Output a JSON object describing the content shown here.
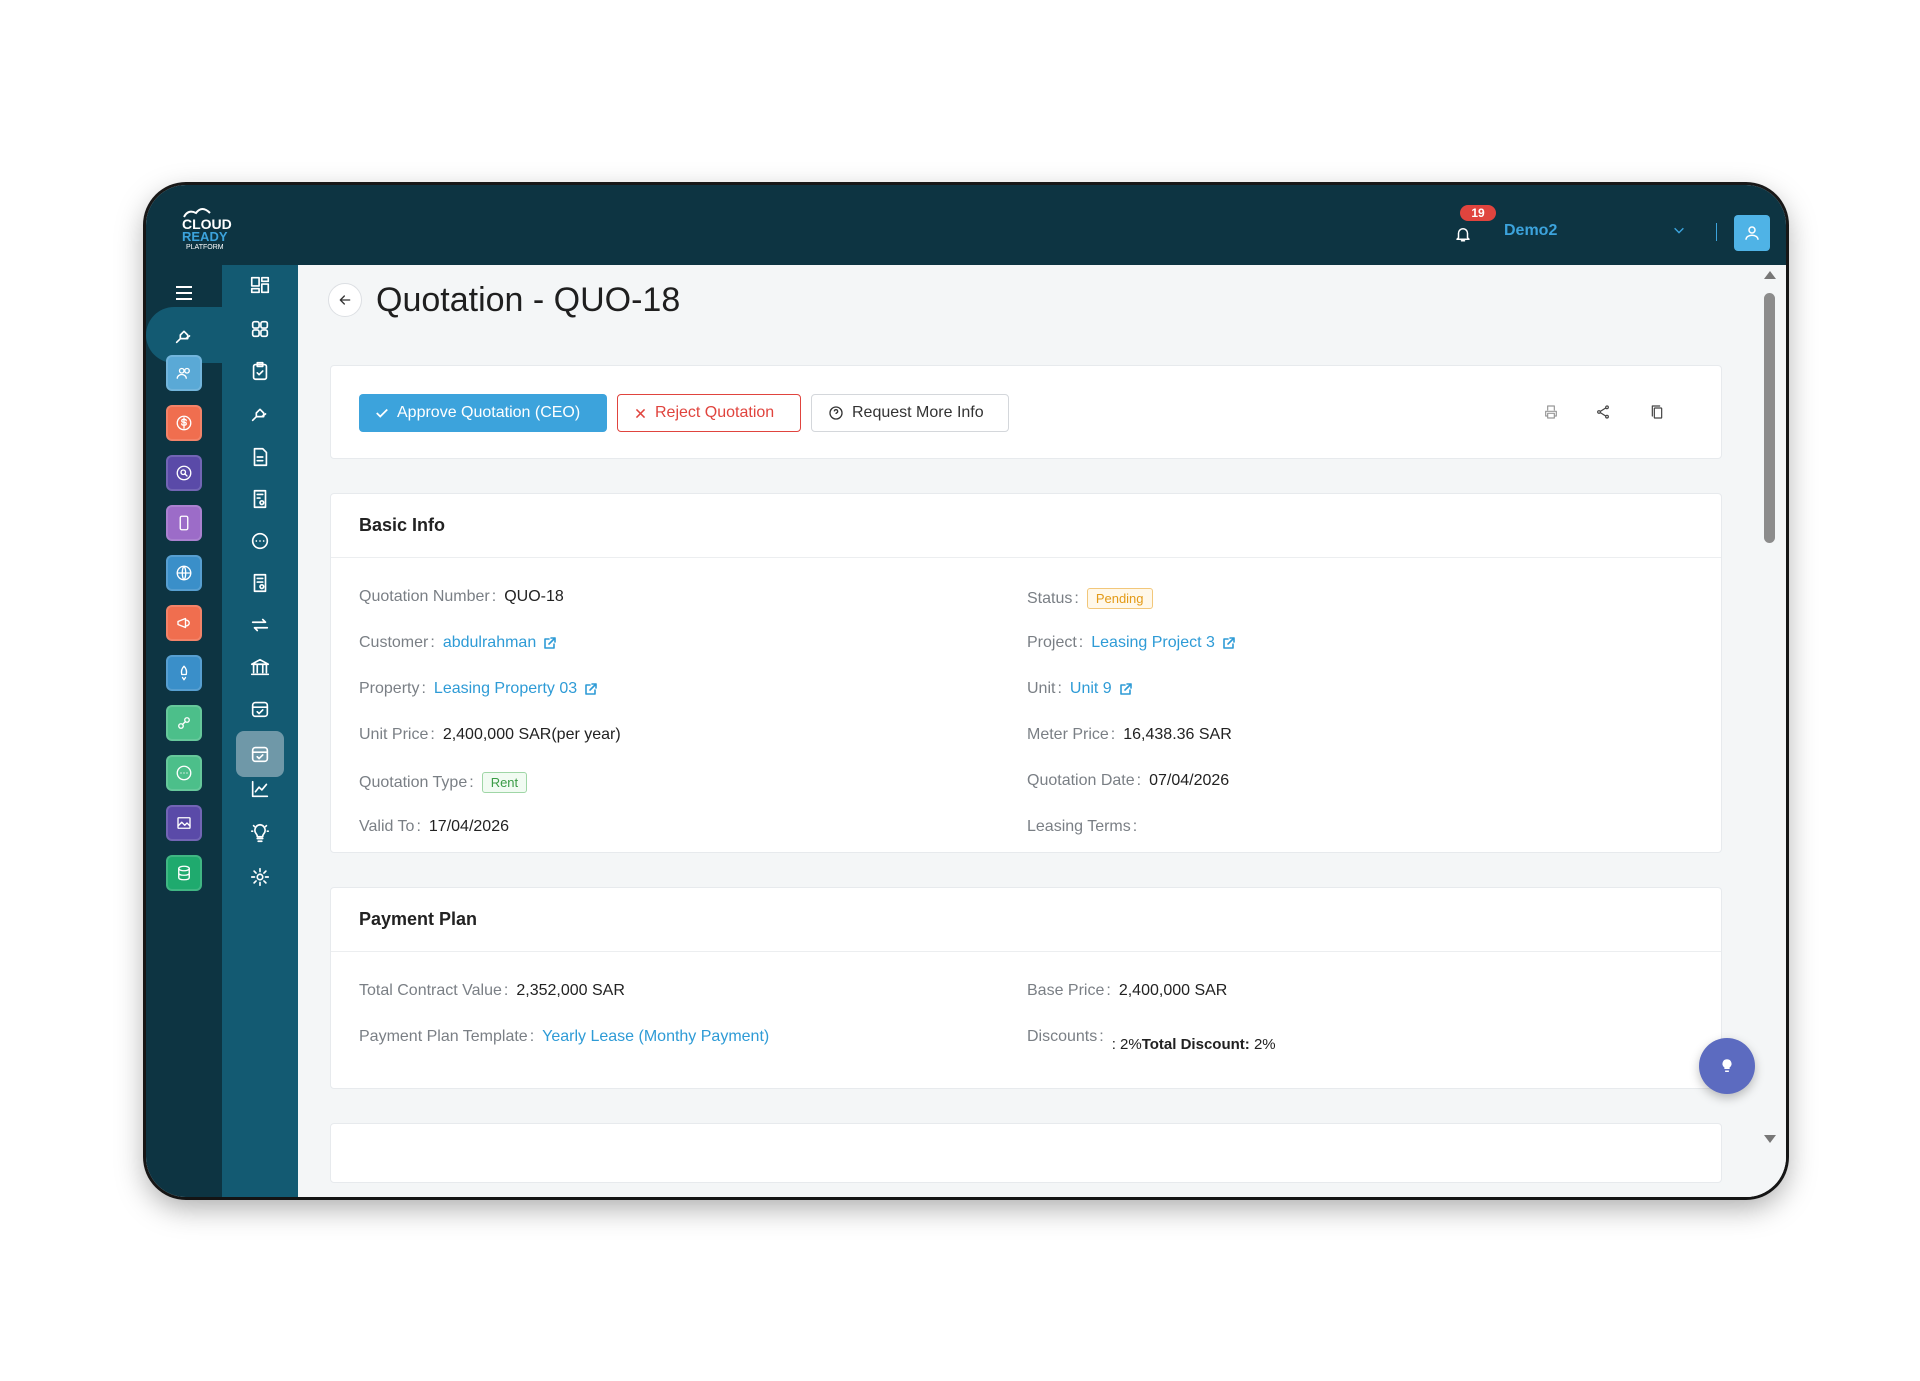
{
  "header": {
    "logo_text": "CLOUD READY PLATFORM",
    "notification_count": "19",
    "user_name": "Demo2"
  },
  "page": {
    "title": "Quotation - QUO-18"
  },
  "actions": {
    "approve_label": "Approve Quotation (CEO)",
    "reject_label": "Reject Quotation",
    "request_info_label": "Request More Info"
  },
  "basic_info": {
    "heading": "Basic Info",
    "quotation_number": {
      "label": "Quotation Number",
      "value": "QUO-18"
    },
    "status": {
      "label": "Status",
      "value": "Pending"
    },
    "customer": {
      "label": "Customer",
      "value": "abdulrahman"
    },
    "project": {
      "label": "Project",
      "value": "Leasing Project 3"
    },
    "property": {
      "label": "Property",
      "value": "Leasing Property 03"
    },
    "unit": {
      "label": "Unit",
      "value": "Unit 9"
    },
    "unit_price": {
      "label": "Unit Price",
      "value": "2,400,000 SAR(per year)"
    },
    "meter_price": {
      "label": "Meter Price",
      "value": "16,438.36 SAR"
    },
    "quotation_type": {
      "label": "Quotation Type",
      "value": "Rent"
    },
    "quotation_date": {
      "label": "Quotation Date",
      "value": "07/04/2026"
    },
    "valid_to": {
      "label": "Valid To",
      "value": "17/04/2026"
    },
    "leasing_terms": {
      "label": "Leasing Terms",
      "value": ""
    }
  },
  "payment_plan": {
    "heading": "Payment Plan",
    "total_contract_value": {
      "label": "Total Contract Value",
      "value": "2,352,000 SAR"
    },
    "base_price": {
      "label": "Base Price",
      "value": "2,400,000 SAR"
    },
    "template": {
      "label": "Payment Plan Template",
      "value": "Yearly Lease (Monthy Payment)"
    },
    "discounts": {
      "label": "Discounts",
      "value_prefix": ": 2%",
      "total_label": "Total Discount:",
      "total_value": "2%"
    }
  },
  "colors": {
    "topbar": "#0d3442",
    "rail_secondary": "#135a72",
    "accent": "#3ca3dc",
    "danger": "#e0443e",
    "pending": "#e39a17",
    "rent": "#3a9b46",
    "fab": "#5c6bc0"
  },
  "app_tiles": [
    {
      "icon": "users-icon",
      "color": "#5aa9d6"
    },
    {
      "icon": "dollar-icon",
      "color": "#f06e4f"
    },
    {
      "icon": "search-icon",
      "color": "#5a4aa8"
    },
    {
      "icon": "mobile-icon",
      "color": "#9c6cc8"
    },
    {
      "icon": "globe-icon",
      "color": "#3a8fc9"
    },
    {
      "icon": "megaphone-icon",
      "color": "#f06e4f"
    },
    {
      "icon": "rocket-icon",
      "color": "#3a8fc9"
    },
    {
      "icon": "link-icon",
      "color": "#4cbf8a"
    },
    {
      "icon": "chat-icon",
      "color": "#4cbf8a"
    },
    {
      "icon": "image-icon",
      "color": "#5a4aa8"
    },
    {
      "icon": "database-icon",
      "color": "#1faa6e"
    }
  ]
}
